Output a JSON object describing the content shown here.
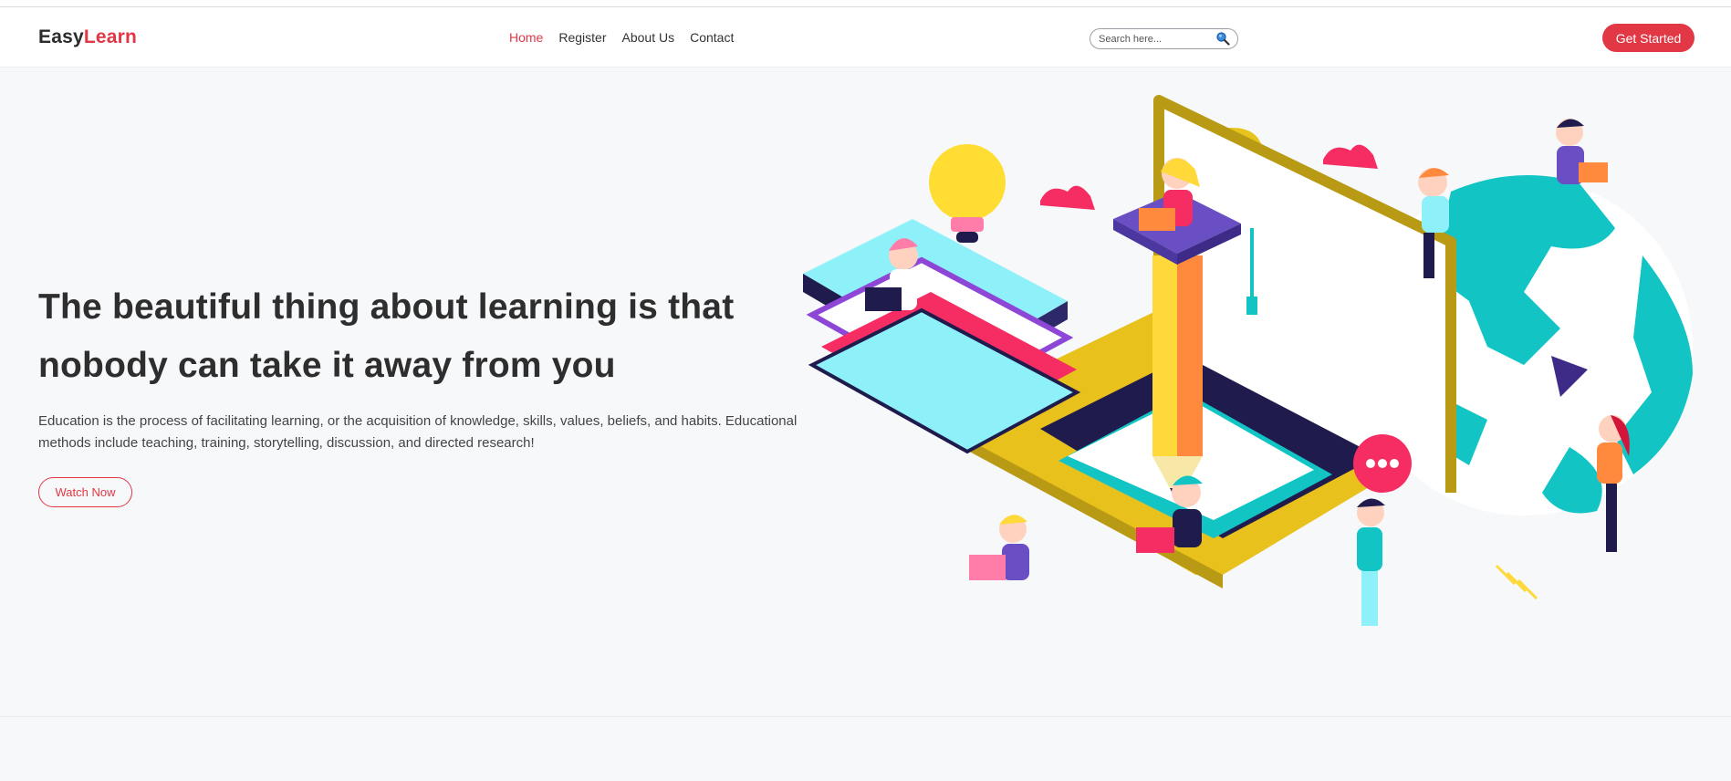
{
  "brand": {
    "part1": "Easy",
    "part2": "Learn"
  },
  "nav": {
    "items": [
      {
        "label": "Home",
        "active": true
      },
      {
        "label": "Register",
        "active": false
      },
      {
        "label": "About Us",
        "active": false
      },
      {
        "label": "Contact",
        "active": false
      }
    ]
  },
  "search": {
    "placeholder": "Search here...",
    "icon": "search-icon"
  },
  "header_button": {
    "label": "Get Started"
  },
  "hero": {
    "title_line1": "The beautiful thing about learning is that",
    "title_line2": "nobody can take it away from you",
    "text": "Education is the process of facilitating learning, or the acquisition of knowledge, skills, values, beliefs, and habits. Educational methods include teaching, training, storytelling, discussion, and directed research!",
    "button_label": "Watch Now"
  },
  "colors": {
    "accent": "#e23744",
    "background": "#f7f8fa",
    "header": "#ffffff",
    "text": "#2e2e2e"
  }
}
